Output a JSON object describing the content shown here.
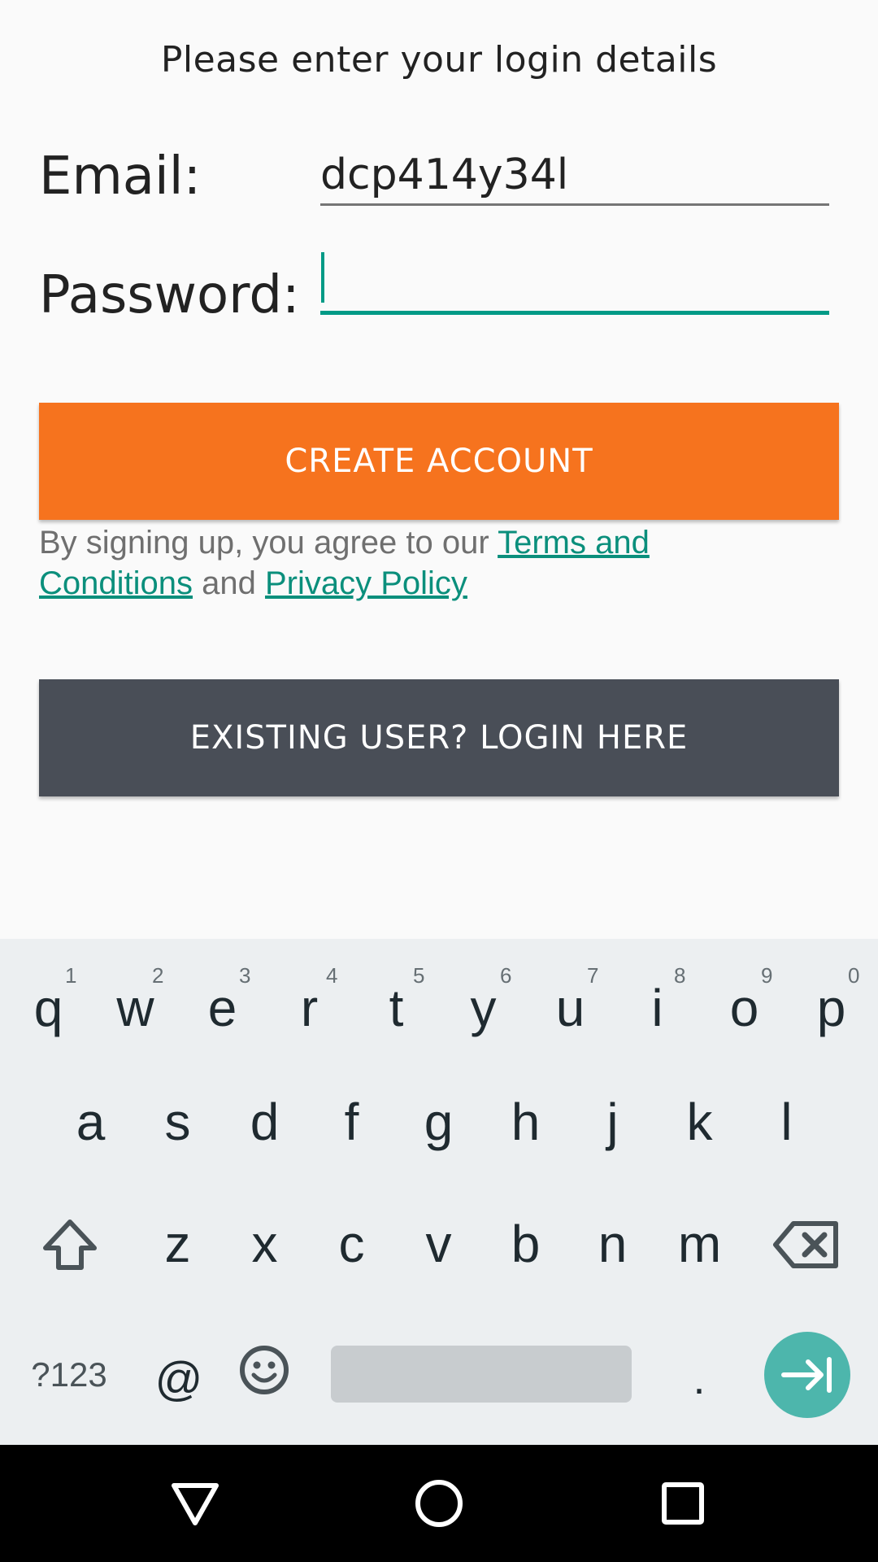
{
  "header": {
    "prompt": "Please enter your login details"
  },
  "form": {
    "email_label": "Email:",
    "email_value": "dcp414y34l",
    "password_label": "Password:",
    "password_value": ""
  },
  "buttons": {
    "create_account": "CREATE ACCOUNT",
    "existing_user": "EXISTING USER? LOGIN HERE"
  },
  "terms": {
    "prefix": "By signing up, you agree to our ",
    "terms_link": "Terms and Conditions",
    "middle": " and ",
    "privacy_link": "Privacy Policy"
  },
  "keyboard": {
    "row1": [
      {
        "key": "q",
        "hint": "1"
      },
      {
        "key": "w",
        "hint": "2"
      },
      {
        "key": "e",
        "hint": "3"
      },
      {
        "key": "r",
        "hint": "4"
      },
      {
        "key": "t",
        "hint": "5"
      },
      {
        "key": "y",
        "hint": "6"
      },
      {
        "key": "u",
        "hint": "7"
      },
      {
        "key": "i",
        "hint": "8"
      },
      {
        "key": "o",
        "hint": "9"
      },
      {
        "key": "p",
        "hint": "0"
      }
    ],
    "row2": [
      "a",
      "s",
      "d",
      "f",
      "g",
      "h",
      "j",
      "k",
      "l"
    ],
    "row3": [
      "z",
      "x",
      "c",
      "v",
      "b",
      "n",
      "m"
    ],
    "symbols_key": "?123",
    "at_key": "@",
    "period_key": ".",
    "shift_icon": "shift-icon",
    "backspace_icon": "backspace-icon",
    "emoji_icon": "emoji-icon",
    "enter_icon": "next-arrow-icon"
  },
  "navbar": {
    "back_icon": "back-triangle-icon",
    "home_icon": "home-circle-icon",
    "recents_icon": "recents-square-icon"
  },
  "colors": {
    "accent": "#009a86",
    "create_button": "#f6731e",
    "login_button": "#494e57",
    "enter_key": "#4db6ac"
  }
}
